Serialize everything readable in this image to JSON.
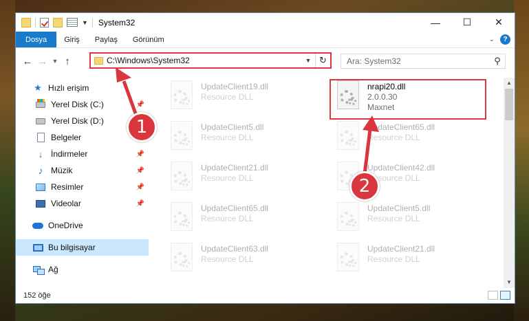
{
  "window": {
    "title": "System32",
    "controls": {
      "minimize": "—",
      "maximize": "☐",
      "close": "✕"
    }
  },
  "ribbon": {
    "tabs": [
      "Dosya",
      "Giriş",
      "Paylaş",
      "Görünüm"
    ]
  },
  "navigation": {
    "address": "C:\\Windows\\System32",
    "search_placeholder": "Ara: System32"
  },
  "sidebar": {
    "items": [
      {
        "label": "Hızlı erişim",
        "icon": "star-icon",
        "pinned": false
      },
      {
        "label": "Yerel Disk (C:)",
        "icon": "drive-c-icon",
        "pinned": true
      },
      {
        "label": "Yerel Disk (D:)",
        "icon": "drive-icon",
        "pinned": false
      },
      {
        "label": "Belgeler",
        "icon": "documents-icon",
        "pinned": true
      },
      {
        "label": "İndirmeler",
        "icon": "downloads-icon",
        "pinned": true
      },
      {
        "label": "Müzik",
        "icon": "music-icon",
        "pinned": true
      },
      {
        "label": "Resimler",
        "icon": "pictures-icon",
        "pinned": true
      },
      {
        "label": "Videolar",
        "icon": "videos-icon",
        "pinned": true
      },
      {
        "label": "OneDrive",
        "icon": "onedrive-icon",
        "pinned": false
      },
      {
        "label": "Bu bilgisayar",
        "icon": "this-pc-icon",
        "pinned": false,
        "selected": true
      },
      {
        "label": "Ağ",
        "icon": "network-icon",
        "pinned": false
      }
    ]
  },
  "files": {
    "highlighted": {
      "name": "nrapi20.dll",
      "version": "2.0.0.30",
      "company": "Maxnet"
    },
    "left_column": [
      {
        "name": "UpdateClient19.dll",
        "type": "Resource DLL"
      },
      {
        "name": "UpdateClient5.dll",
        "type": "Resource DLL"
      },
      {
        "name": "UpdateClient21.dll",
        "type": "Resource DLL"
      },
      {
        "name": "UpdateClient65.dll",
        "type": "Resource DLL"
      },
      {
        "name": "UpdateClient63.dll",
        "type": "Resource DLL"
      }
    ],
    "right_column": [
      {
        "name": "UpdateClient65.dll",
        "type": "Resource DLL"
      },
      {
        "name": "UpdateClient42.dll",
        "type": "Resource DLL"
      },
      {
        "name": "UpdateClient5.dll",
        "type": "Resource DLL"
      },
      {
        "name": "UpdateClient21.dll",
        "type": "Resource DLL"
      }
    ]
  },
  "status": {
    "item_count": "152 öğe"
  },
  "annotations": {
    "step1": "1",
    "step2": "2",
    "accent_color": "#d9373d"
  }
}
